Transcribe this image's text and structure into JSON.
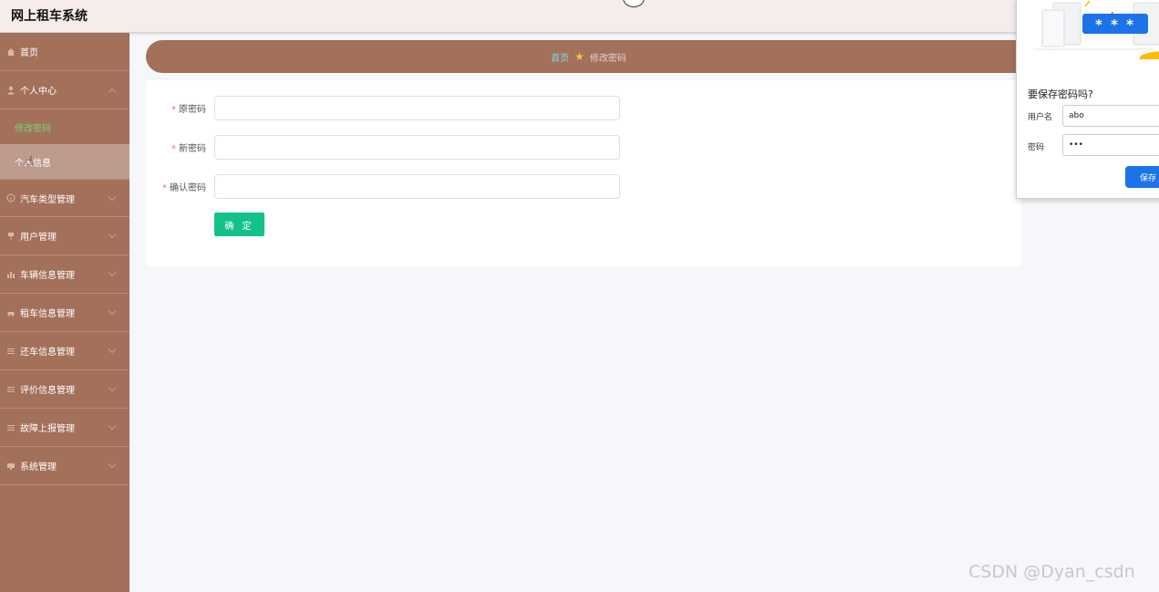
{
  "header": {
    "title": "网上租车系统"
  },
  "sidebar": {
    "home": {
      "label": "首页",
      "icon": "home-icon"
    },
    "personal_center": {
      "label": "个人中心",
      "icon": "user-icon",
      "children": [
        {
          "label": "修改密码"
        },
        {
          "label": "个人信息"
        }
      ]
    },
    "items": [
      {
        "label": "汽车类型管理",
        "icon": "info-circle-icon"
      },
      {
        "label": "用户管理",
        "icon": "pin-icon"
      },
      {
        "label": "车辆信息管理",
        "icon": "bar-chart-icon"
      },
      {
        "label": "租车信息管理",
        "icon": "car-icon"
      },
      {
        "label": "还车信息管理",
        "icon": "list-icon"
      },
      {
        "label": "评价信息管理",
        "icon": "list-icon"
      },
      {
        "label": "故障上报管理",
        "icon": "list-icon"
      },
      {
        "label": "系统管理",
        "icon": "monitor-icon"
      }
    ]
  },
  "breadcrumb": {
    "home": "首页",
    "current": "修改密码"
  },
  "form": {
    "old_password_label": "原密码",
    "new_password_label": "新密码",
    "confirm_password_label": "确认密码",
    "required_mark": "*",
    "submit_label": "确 定"
  },
  "password_popup": {
    "masked": "* * *",
    "title": "要保存密码吗?",
    "username_label": "用户名",
    "username_value": "abo",
    "password_label": "密码",
    "password_value": "•••",
    "save_label": "保存"
  },
  "watermark": "CSDN @Dyan_csdn"
}
